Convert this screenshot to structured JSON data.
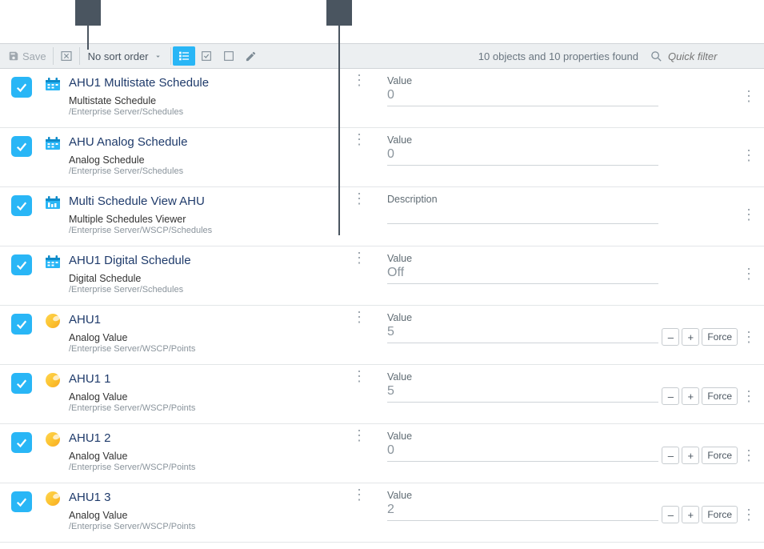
{
  "toolbar": {
    "save_label": "Save",
    "sort_label": "No sort order",
    "status_text": "10 objects and 10 properties found",
    "search_placeholder": "Quick filter"
  },
  "rows": [
    {
      "icon": "calendar",
      "name": "AHU1 Multistate Schedule",
      "type": "Multistate Schedule",
      "path": "/Enterprise Server/Schedules",
      "prop_label": "Value",
      "prop_value": "0",
      "actions": false
    },
    {
      "icon": "calendar",
      "name": "AHU Analog Schedule",
      "type": "Analog Schedule",
      "path": "/Enterprise Server/Schedules",
      "prop_label": "Value",
      "prop_value": "0",
      "actions": false
    },
    {
      "icon": "calendar-bars",
      "name": "Multi Schedule View AHU",
      "type": "Multiple Schedules Viewer",
      "path": "/Enterprise Server/WSCP/Schedules",
      "prop_label": "Description",
      "prop_value": "",
      "actions": false
    },
    {
      "icon": "calendar",
      "name": "AHU1 Digital Schedule",
      "type": "Digital Schedule",
      "path": "/Enterprise Server/Schedules",
      "prop_label": "Value",
      "prop_value": "Off",
      "actions": false
    },
    {
      "icon": "ball",
      "name": "AHU1",
      "type": "Analog Value",
      "path": "/Enterprise Server/WSCP/Points",
      "prop_label": "Value",
      "prop_value": "5",
      "actions": true
    },
    {
      "icon": "ball",
      "name": "AHU1 1",
      "type": "Analog Value",
      "path": "/Enterprise Server/WSCP/Points",
      "prop_label": "Value",
      "prop_value": "5",
      "actions": true
    },
    {
      "icon": "ball",
      "name": "AHU1 2",
      "type": "Analog Value",
      "path": "/Enterprise Server/WSCP/Points",
      "prop_label": "Value",
      "prop_value": "0",
      "actions": true
    },
    {
      "icon": "ball",
      "name": "AHU1 3",
      "type": "Analog Value",
      "path": "/Enterprise Server/WSCP/Points",
      "prop_label": "Value",
      "prop_value": "2",
      "actions": true
    }
  ],
  "action_labels": {
    "minus": "–",
    "plus": "+",
    "force": "Force"
  }
}
